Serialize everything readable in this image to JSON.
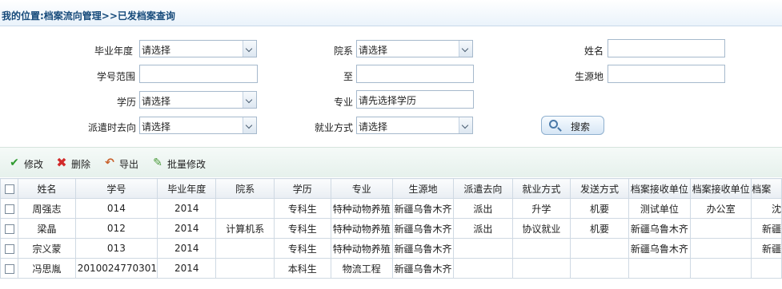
{
  "breadcrumb": "我的位置:档案流向管理>>已发档案查询",
  "form": {
    "graduation_year": {
      "label": "毕业年度",
      "value": "请选择"
    },
    "department": {
      "label": "院系",
      "value": "请选择"
    },
    "name": {
      "label": "姓名",
      "value": ""
    },
    "student_id_range": {
      "label": "学号范围",
      "from": "",
      "to_label": "至",
      "to": ""
    },
    "origin": {
      "label": "生源地",
      "value": ""
    },
    "education": {
      "label": "学历",
      "value": "请选择"
    },
    "major": {
      "label": "专业",
      "value": "请先选择学历"
    },
    "dispatch": {
      "label": "派遣时去向",
      "value": "请选择"
    },
    "employment": {
      "label": "就业方式",
      "value": "请选择"
    },
    "search_label": "搜索"
  },
  "toolbar": {
    "edit": "修改",
    "delete": "删除",
    "export": "导出",
    "batch_edit": "批量修改"
  },
  "table": {
    "columns": [
      "姓名",
      "学号",
      "毕业年度",
      "院系",
      "学历",
      "专业",
      "生源地",
      "派遣去向",
      "就业方式",
      "发送方式",
      "档案接收单位",
      "档案接收单位",
      "档案"
    ],
    "rows": [
      [
        "周强志",
        "014",
        "2014",
        "",
        "专科生",
        "特种动物养殖",
        "新疆乌鲁木齐",
        "派出",
        "升学",
        "机要",
        "测试单位",
        "办公室",
        "沈"
      ],
      [
        "梁晶",
        "012",
        "2014",
        "计算机系",
        "专科生",
        "特种动物养殖",
        "新疆乌鲁木齐",
        "派出",
        "协议就业",
        "机要",
        "新疆乌鲁木齐",
        "",
        "新疆"
      ],
      [
        "宗义蒙",
        "013",
        "2014",
        "",
        "专科生",
        "特种动物养殖",
        "新疆乌鲁木齐",
        "",
        "",
        "",
        "新疆乌鲁木齐",
        "",
        "新疆"
      ],
      [
        "冯思胤",
        "2010024770301",
        "2014",
        "",
        "本科生",
        "物流工程",
        "新疆乌鲁木齐",
        "",
        "",
        "",
        "",
        "",
        ""
      ]
    ]
  },
  "colors": {
    "breadcrumb_text": "#164a7a",
    "edit_icon": "#2e9a2e",
    "delete_icon": "#d22a2a",
    "export_icon": "#c8602a",
    "batch_icon": "#4a9a3a"
  },
  "icons": [
    "check-icon",
    "delete-x-icon",
    "export-arrow-icon",
    "pencil-icon",
    "search-icon",
    "chevron-down-icon"
  ]
}
